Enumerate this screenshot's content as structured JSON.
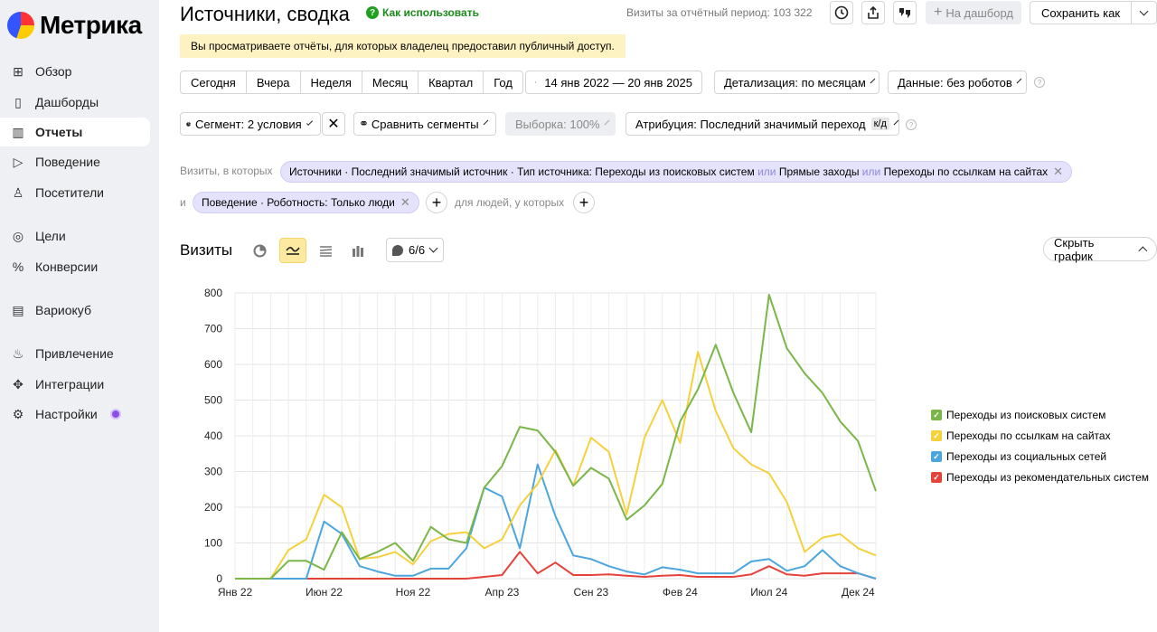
{
  "app": {
    "logo_text": "Метрика"
  },
  "sidebar": {
    "items": [
      {
        "id": "overview",
        "label": "Обзор",
        "icon": "grid-icon",
        "glyph": "⊞",
        "active": false
      },
      {
        "id": "dashboards",
        "label": "Дашборды",
        "icon": "dashboard-icon",
        "glyph": "▯",
        "active": false
      },
      {
        "id": "reports",
        "label": "Отчеты",
        "icon": "bar-chart-icon",
        "glyph": "▥",
        "active": true
      },
      {
        "id": "behavior",
        "label": "Поведение",
        "icon": "play-icon",
        "glyph": "▷",
        "active": false
      },
      {
        "id": "visitors",
        "label": "Посетители",
        "icon": "person-icon",
        "glyph": "♙",
        "active": false
      },
      {
        "id": "goals",
        "label": "Цели",
        "icon": "target-icon",
        "glyph": "◎",
        "active": false
      },
      {
        "id": "conversions",
        "label": "Конверсии",
        "icon": "percent-icon",
        "glyph": "%",
        "active": false
      },
      {
        "id": "variocube",
        "label": "Вариокуб",
        "icon": "cube-icon",
        "glyph": "▤",
        "active": false
      },
      {
        "id": "acquisition",
        "label": "Привлечение",
        "icon": "flame-icon",
        "glyph": "♨",
        "active": false
      },
      {
        "id": "integrations",
        "label": "Интеграции",
        "icon": "puzzle-icon",
        "glyph": "✥",
        "active": false
      },
      {
        "id": "settings",
        "label": "Настройки",
        "icon": "gear-icon",
        "glyph": "⚙",
        "active": false
      }
    ]
  },
  "header": {
    "title": "Источники, сводка",
    "howto_label": "Как использовать",
    "visits_total": "Визиты за отчётный период: 103 322",
    "dashboard_button": "На дашборд",
    "save_button": "Сохранить как"
  },
  "notice": "Вы просматриваете отчёты, для которых владелец предоставил публичный доступ.",
  "periods": [
    "Сегодня",
    "Вчера",
    "Неделя",
    "Месяц",
    "Квартал",
    "Год"
  ],
  "date_range": "14 янв 2022 — 20 янв 2025",
  "detail_select": "Детализация: по месяцам",
  "data_select": "Данные: без роботов",
  "segment_select": "Сегмент: 2 условия",
  "compare_select": "Сравнить сегменты",
  "sample_select": "Выборка: 100%",
  "attribution": {
    "label": "Атрибуция: Последний значимый переход",
    "tag": "к/д"
  },
  "filters": {
    "prefix": "Визиты, в которых",
    "conjunction": "и",
    "people_label": "для людей, у которых",
    "chip1": {
      "head": "Источники · Последний значимый источник · Тип источника: Переходы из поисковых систем",
      "or1": "или",
      "part2": "Прямые заходы",
      "or2": "или",
      "part3": "Переходы по ссылкам на сайтах"
    },
    "chip2": "Поведение · Роботность: Только люди"
  },
  "chart_section": {
    "title": "Визиты",
    "series_count": "6/6",
    "hide_button": "Скрыть график"
  },
  "chart_data": {
    "type": "line",
    "ylabel": "",
    "xlabel": "",
    "ylim": [
      0,
      800
    ],
    "yticks": [
      0,
      100,
      200,
      300,
      400,
      500,
      600,
      700,
      800
    ],
    "x_start": "2022-01",
    "x_ticks": [
      "Янв 22",
      "Июн 22",
      "Ноя 22",
      "Апр 23",
      "Сен 23",
      "Фев 24",
      "Июл 24",
      "Дек 24"
    ],
    "series": [
      {
        "name": "Переходы из поисковых систем",
        "color": "#7ab648",
        "values": [
          0,
          0,
          0,
          50,
          50,
          25,
          130,
          55,
          75,
          100,
          50,
          145,
          110,
          100,
          255,
          315,
          425,
          415,
          355,
          260,
          310,
          280,
          165,
          205,
          265,
          440,
          530,
          655,
          520,
          410,
          795,
          645,
          575,
          520,
          440,
          385,
          245
        ]
      },
      {
        "name": "Переходы по ссылкам на сайтах",
        "color": "#f4d13d",
        "values": [
          0,
          0,
          0,
          80,
          110,
          235,
          200,
          55,
          60,
          75,
          40,
          105,
          125,
          130,
          85,
          110,
          205,
          265,
          360,
          260,
          395,
          355,
          180,
          395,
          500,
          380,
          635,
          470,
          365,
          320,
          295,
          215,
          75,
          115,
          125,
          85,
          65
        ]
      },
      {
        "name": "Переходы из социальных сетей",
        "color": "#4ba6dd",
        "values": [
          0,
          0,
          0,
          0,
          0,
          160,
          125,
          35,
          20,
          8,
          8,
          28,
          28,
          85,
          255,
          230,
          85,
          320,
          175,
          65,
          55,
          35,
          20,
          12,
          32,
          25,
          15,
          15,
          15,
          48,
          55,
          22,
          35,
          80,
          35,
          15,
          0
        ]
      },
      {
        "name": "Переходы из рекомендательных систем",
        "color": "#e5433a",
        "values": [
          0,
          0,
          0,
          0,
          0,
          0,
          0,
          0,
          0,
          0,
          0,
          0,
          0,
          0,
          5,
          10,
          75,
          15,
          45,
          10,
          10,
          12,
          8,
          5,
          8,
          10,
          5,
          5,
          5,
          12,
          35,
          12,
          8,
          15,
          15,
          15,
          0
        ]
      }
    ],
    "legend_position": "right",
    "grid": true
  }
}
